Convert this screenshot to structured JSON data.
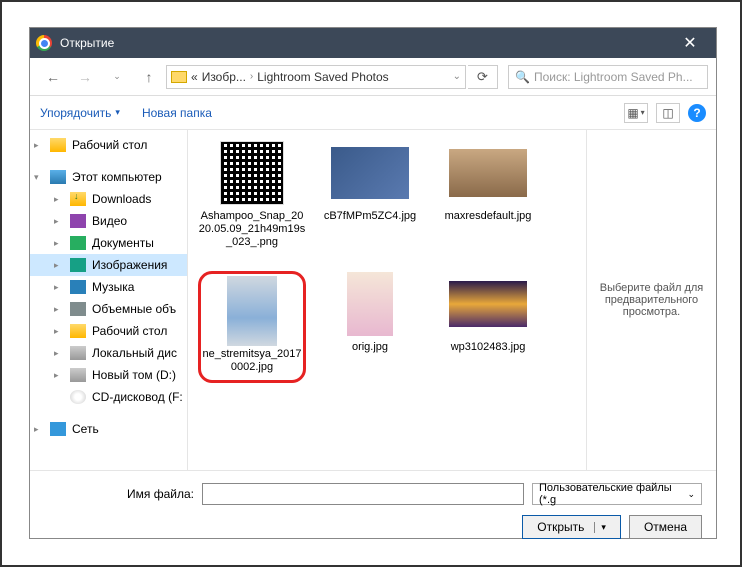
{
  "title": "Открытие",
  "close_glyph": "✕",
  "nav": {
    "back": "←",
    "forward": "→",
    "up": "↑",
    "breadcrumb_prefix": "«",
    "crumb1": "Изобр...",
    "crumb2": "Lightroom Saved Photos",
    "dropdown_glyph": "⌄",
    "refresh_glyph": "⟳",
    "search_placeholder": "Поиск: Lightroom Saved Ph..."
  },
  "toolbar": {
    "organize": "Упорядочить",
    "new_folder": "Новая папка",
    "help_glyph": "?"
  },
  "sidebar": {
    "desktop": "Рабочий стол",
    "this_pc": "Этот компьютер",
    "downloads": "Downloads",
    "video": "Видео",
    "documents": "Документы",
    "images": "Изображения",
    "music": "Музыка",
    "volumes": "Объемные объ",
    "desktop2": "Рабочий стол",
    "local_disk": "Локальный дис",
    "new_vol": "Новый том (D:)",
    "cd": "CD-дисковод (F:",
    "network": "Сеть"
  },
  "files": {
    "f1": "Ashampoo_Snap_2020.05.09_21h49m19s_023_.png",
    "f2": "cB7fMPm5ZC4.jpg",
    "f3": "maxresdefault.jpg",
    "f4": "ne_stremitsya_20170002.jpg",
    "f5": "orig.jpg",
    "f6": "wp3102483.jpg"
  },
  "preview": "Выберите файл для предварительного просмотра.",
  "bottom": {
    "filename_label": "Имя файла:",
    "filename_value": "",
    "filetype": "Пользовательские файлы (*.g",
    "open": "Открыть",
    "cancel": "Отмена"
  }
}
